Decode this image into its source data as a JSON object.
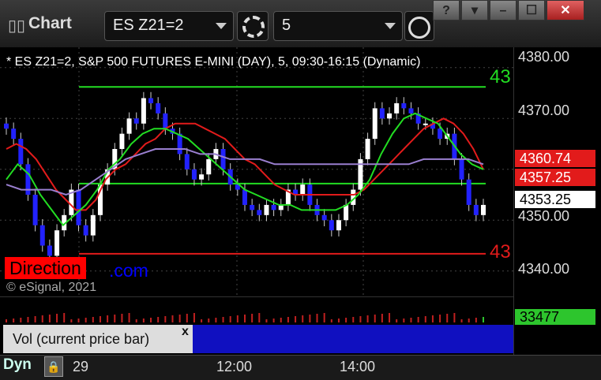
{
  "window": {
    "app_title": "Chart",
    "app_icon": "chart-window-icon",
    "controls": [
      "help-icon",
      "dropdown-window-icon",
      "minimize-icon",
      "maximize-icon",
      "close-icon"
    ],
    "help_label": "?",
    "minimize_label": "–",
    "maximize_label": "☐",
    "close_label": "✕"
  },
  "toolbar": {
    "symbol": "ES Z21=2",
    "interval": "5",
    "settings_icon": "gear-icon",
    "time_icon": "clock-icon"
  },
  "chart": {
    "caption": "* ES Z21=2, S&P 500 FUTURES E-MINI (DAY), 5, 09:30-16:15 (Dynamic)",
    "green_level_label": "43",
    "red_level_label": "43",
    "direction_label": "Direction",
    "direction_suffix": ".com",
    "copyright": "© eSignal, 2021",
    "colors": {
      "background": "#000000",
      "up_candle": "#ffffff",
      "down_candle": "#2222ff",
      "ma_red": "#e21b1b",
      "ma_green": "#22dd22",
      "ma_purple": "#9a7fd0",
      "level_green": "#22dd22",
      "level_red": "#e21b1b"
    }
  },
  "price_axis": {
    "ticks": [
      "4380.00",
      "4370.00",
      "4360.00",
      "4350.00",
      "4340.00"
    ],
    "tags": [
      {
        "value": "4360.74",
        "bg": "#e21b1b",
        "fg": "#ffffff"
      },
      {
        "value": "4357.25",
        "bg": "#e21b1b",
        "fg": "#ffffff"
      },
      {
        "value": "4353.25",
        "bg": "#ffffff",
        "fg": "#000000"
      }
    ]
  },
  "volume": {
    "label": "Vol (current price bar)",
    "close_label": "x",
    "value": "33477",
    "color": "#2dc52d"
  },
  "timebar": {
    "mode": "Dyn",
    "lock_icon": "lock-icon",
    "ticks": [
      "29",
      "12:00",
      "14:00"
    ]
  },
  "chart_data": {
    "type": "candlestick",
    "title": "* ES Z21=2, S&P 500 FUTURES E-MINI (DAY), 5, 09:30-16:15 (Dynamic)",
    "ylim": [
      4335,
      4384
    ],
    "y_ticks": [
      4340,
      4350,
      4360,
      4370,
      4380
    ],
    "x_ticks": [
      "29",
      "12:00",
      "14:00"
    ],
    "levels": [
      {
        "price": 4376.2,
        "color": "green"
      },
      {
        "price": 4357.2,
        "color": "green"
      },
      {
        "price": 4343.4,
        "color": "red"
      }
    ],
    "candles_close": [
      4368,
      4366,
      4361,
      4355,
      4349,
      4345,
      4343,
      4348,
      4351,
      4356,
      4349,
      4347,
      4351,
      4357,
      4360,
      4364,
      4367,
      4370,
      4369,
      4374,
      4373,
      4371,
      4368,
      4367,
      4363,
      4360,
      4358,
      4359,
      4362,
      4364,
      4360,
      4357,
      4356,
      4353,
      4352,
      4351,
      4353,
      4352,
      4353,
      4356,
      4355,
      4357,
      4353,
      4351,
      4350,
      4348,
      4350,
      4353,
      4356,
      4362,
      4366,
      4372,
      4370,
      4371,
      4373,
      4372,
      4371,
      4369,
      4369,
      4368,
      4366,
      4367,
      4362,
      4358,
      4353,
      4351,
      4353
    ],
    "series": [
      {
        "name": "MA red",
        "values": [
          4364,
          4365,
          4364,
          4362,
          4359,
          4356,
          4354,
          4352,
          4352,
          4354,
          4358,
          4360,
          4361,
          4363,
          4365,
          4366,
          4368,
          4369,
          4369,
          4369,
          4368,
          4367,
          4366,
          4364,
          4362,
          4361,
          4359,
          4357,
          4356,
          4355,
          4355,
          4355,
          4355,
          4355,
          4355,
          4355,
          4356,
          4358,
          4360,
          4362,
          4364,
          4366,
          4368,
          4369,
          4370,
          4369,
          4367,
          4364,
          4360
        ]
      },
      {
        "name": "MA green",
        "values": [
          4358,
          4361,
          4359,
          4355,
          4352,
          4349,
          4351,
          4353,
          4356,
          4360,
          4362,
          4365,
          4367,
          4368,
          4368,
          4367,
          4366,
          4364,
          4362,
          4360,
          4358,
          4356,
          4355,
          4354,
          4353,
          4353,
          4352,
          4352,
          4352,
          4352,
          4353,
          4355,
          4358,
          4363,
          4367,
          4370,
          4371,
          4370,
          4369,
          4366,
          4363,
          4361,
          4360
        ]
      },
      {
        "name": "MA purple",
        "values": [
          4357,
          4356,
          4356,
          4356,
          4355,
          4356,
          4358,
          4360,
          4362,
          4363,
          4364,
          4364,
          4364,
          4363,
          4363,
          4362,
          4362,
          4362,
          4361,
          4361,
          4361,
          4361,
          4361,
          4361,
          4361,
          4361,
          4361,
          4361,
          4362,
          4362,
          4362,
          4362,
          4361
        ]
      }
    ],
    "volume_value": 33477
  }
}
